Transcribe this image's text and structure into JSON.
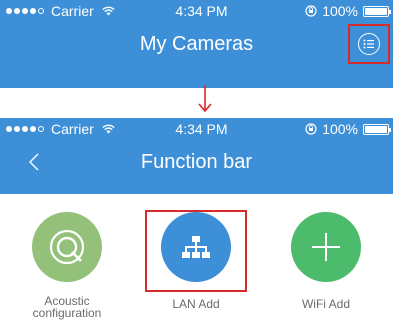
{
  "screen1": {
    "status_bar": {
      "carrier": "Carrier",
      "time": "4:34 PM",
      "battery": "100%"
    },
    "nav": {
      "title": "My Cameras",
      "menu_icon": "list-menu-icon"
    }
  },
  "screen2": {
    "status_bar": {
      "carrier": "Carrier",
      "time": "4:34 PM",
      "battery": "100%"
    },
    "nav": {
      "title": "Function bar",
      "back_icon": "chevron-left-icon"
    }
  },
  "functions": [
    {
      "label_line1": "Acoustic",
      "label_line2": "configuration",
      "icon": "acoustic-icon",
      "color": "#93c179"
    },
    {
      "label": "LAN Add",
      "icon": "network-icon",
      "color": "#3d8fd8"
    },
    {
      "label": "WiFi Add",
      "icon": "plus-icon",
      "color": "#4cbb6b"
    }
  ],
  "colors": {
    "header_blue": "#3d8fd8",
    "highlight_red": "#d62b2b",
    "label_gray": "#6b6b6b"
  }
}
